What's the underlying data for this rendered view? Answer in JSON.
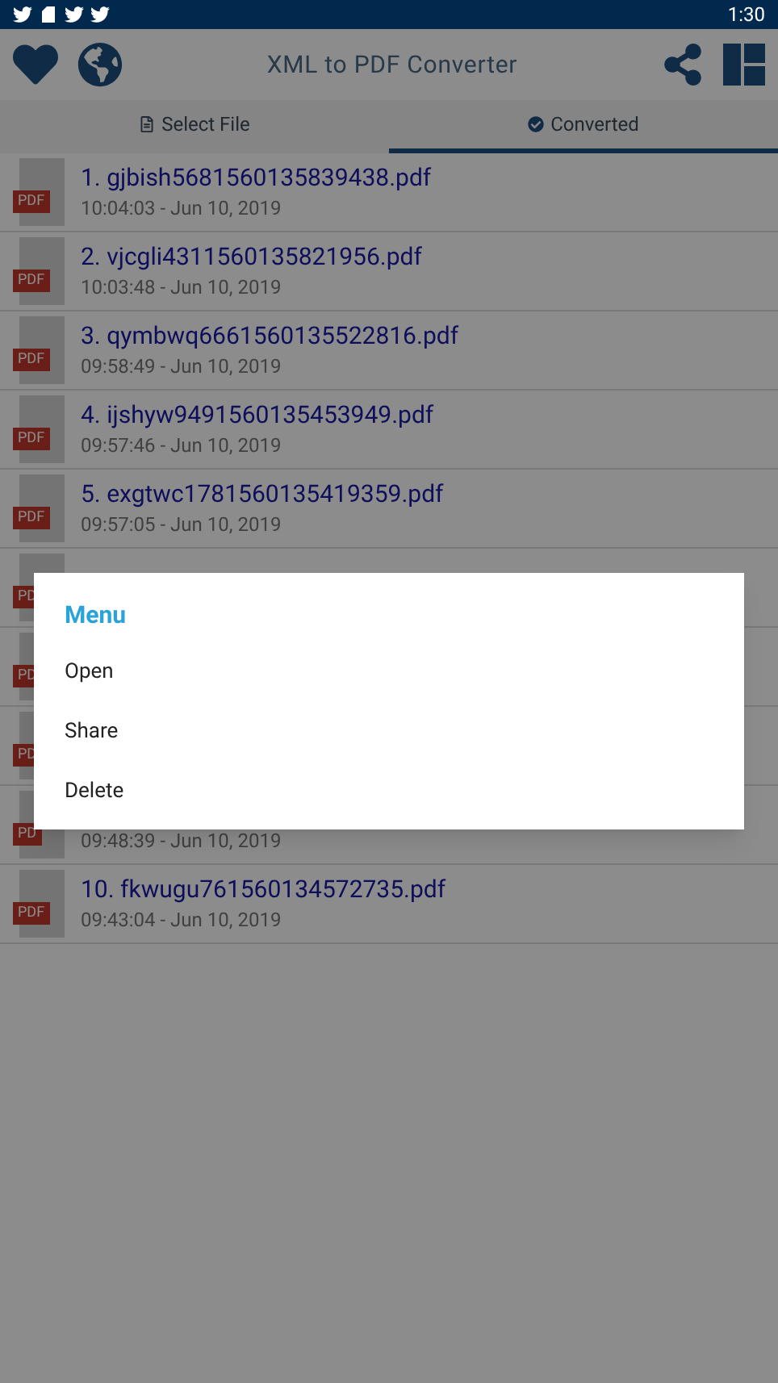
{
  "status_bar": {
    "time": "1:30"
  },
  "app_bar": {
    "title": "XML to PDF Converter"
  },
  "tabs": [
    {
      "label": "Select File",
      "selected": false
    },
    {
      "label": "Converted",
      "selected": true
    }
  ],
  "files": [
    {
      "name": "1. gjbish5681560135839438.pdf",
      "date": "10:04:03 - Jun 10, 2019",
      "badge": "PDF"
    },
    {
      "name": "2. vjcgli4311560135821956.pdf",
      "date": "10:03:48 - Jun 10, 2019",
      "badge": "PDF"
    },
    {
      "name": "3. qymbwq6661560135522816.pdf",
      "date": "09:58:49 - Jun 10, 2019",
      "badge": "PDF"
    },
    {
      "name": "4. ijshyw9491560135453949.pdf",
      "date": "09:57:46 - Jun 10, 2019",
      "badge": "PDF"
    },
    {
      "name": "5. exgtwc1781560135419359.pdf",
      "date": "09:57:05 - Jun 10, 2019",
      "badge": "PDF"
    },
    {
      "badge": "PD"
    },
    {
      "badge": "PD"
    },
    {
      "badge": "PD"
    },
    {
      "date": "09:48:39 - Jun 10, 2019",
      "badge": "PD"
    },
    {
      "name": "10. fkwugu761560134572735.pdf",
      "date": "09:43:04 - Jun 10, 2019",
      "badge": "PDF"
    }
  ],
  "dialog": {
    "title": "Menu",
    "items": [
      "Open",
      "Share",
      "Delete"
    ]
  }
}
